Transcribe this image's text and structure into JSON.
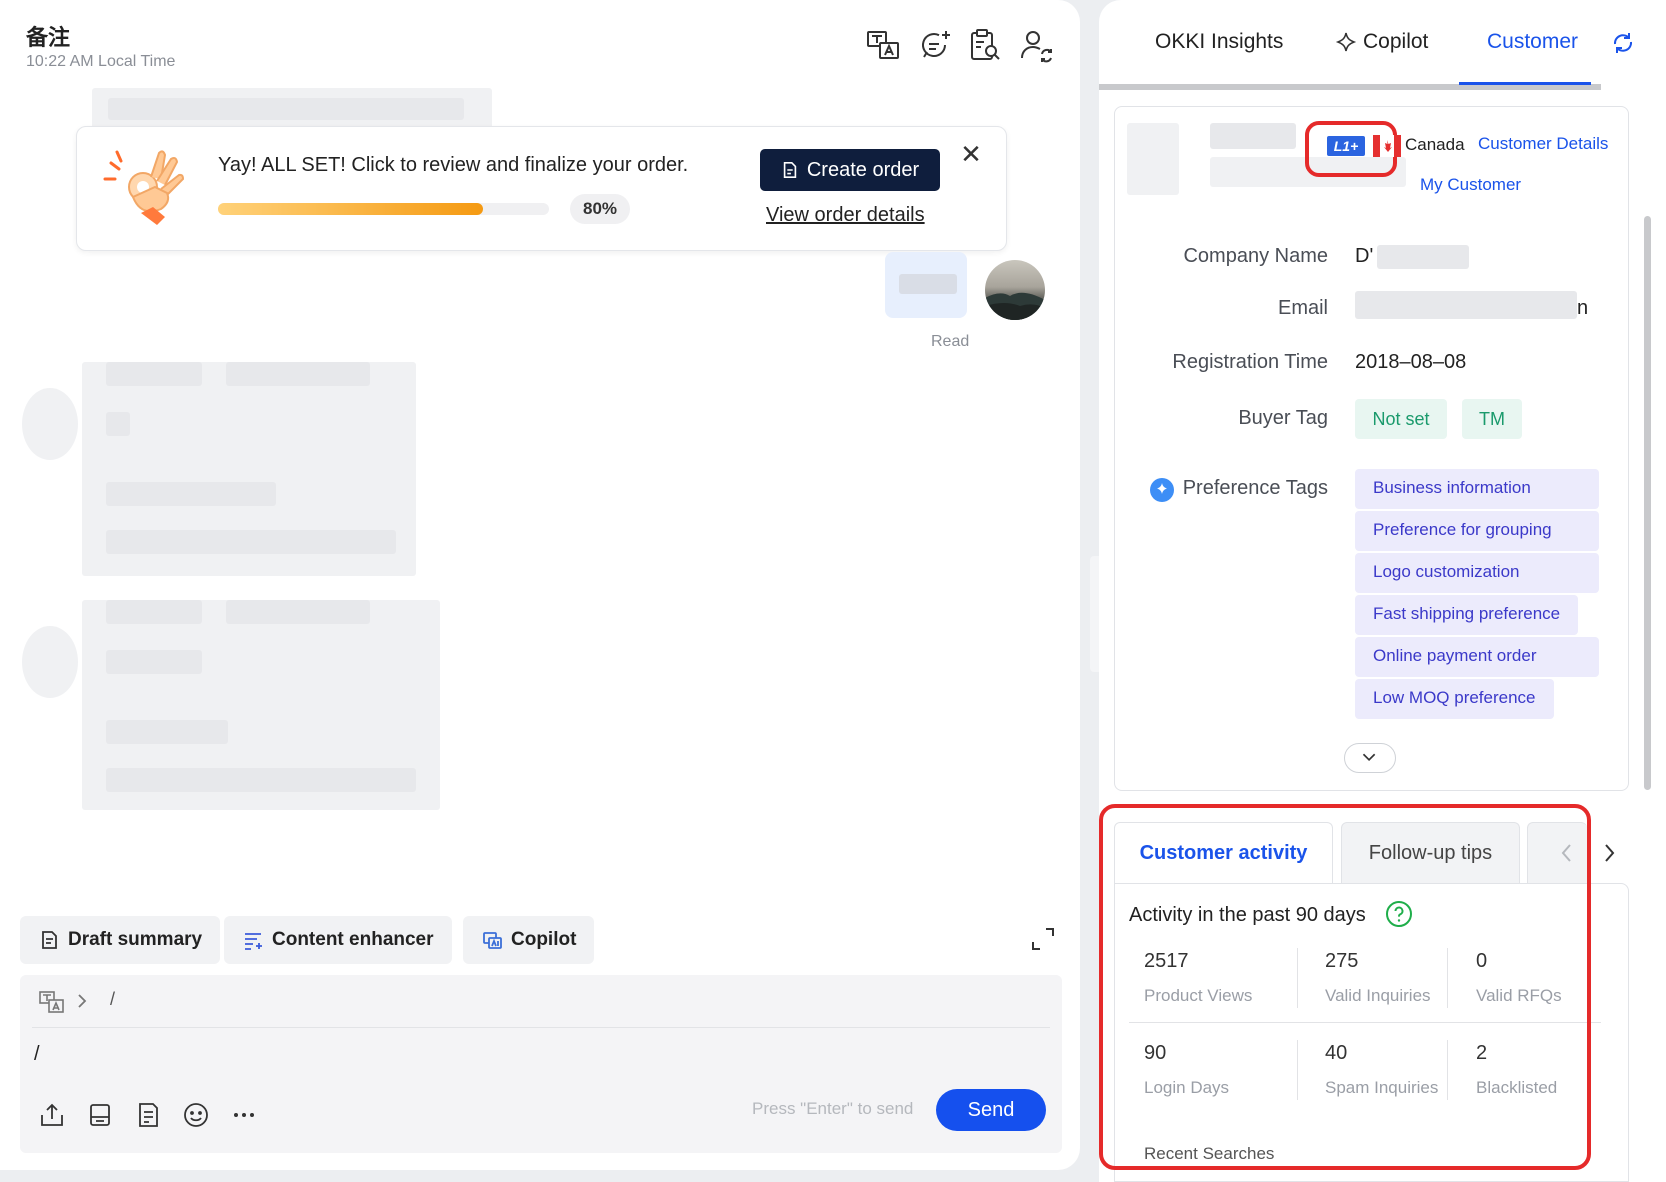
{
  "header": {
    "title": "备注",
    "local_time": "10:22 AM Local Time",
    "icons": [
      "translate-icon",
      "add-chat-icon",
      "clipboard-search-icon",
      "customer-sync-icon"
    ]
  },
  "order_card": {
    "message": "Yay! ALL SET! Click to review and finalize your order.",
    "progress": 80,
    "progress_label": "80%",
    "create_label": "Create order",
    "view_label": "View order details",
    "close_label": "✕"
  },
  "message_status": "Read",
  "assistants": {
    "draft_summary": "Draft summary",
    "content_enhancer": "Content enhancer",
    "copilot": "Copilot"
  },
  "composer": {
    "path_separator": "/",
    "input_value": "/",
    "hint": "Press \"Enter\" to send",
    "send_label": "Send"
  },
  "side_tabs": {
    "insights": "OKKI Insights",
    "copilot": "Copilot",
    "customer": "Customer"
  },
  "customer": {
    "level_badge": "L1+",
    "country": "Canada",
    "details_link": "Customer Details",
    "my_customer_link": "My Customer",
    "company_label": "Company Name",
    "company_value": "D'",
    "email_label": "Email",
    "email_value_tail": "n",
    "registration_label": "Registration Time",
    "registration_value": "2018–08–08",
    "buyer_tag_label": "Buyer Tag",
    "buyer_tags": [
      "Not set",
      "TM"
    ],
    "preference_label": "Preference Tags",
    "preference_tags": [
      "Business information",
      "Preference for grouping",
      "Logo customization",
      "Fast shipping preference",
      "Online payment order",
      "Low MOQ preference"
    ]
  },
  "activity": {
    "tabs": [
      "Customer activity",
      "Follow-up tips"
    ],
    "heading": "Activity in the past 90 days",
    "stats": [
      {
        "value": "2517",
        "label": "Product Views"
      },
      {
        "value": "275",
        "label": "Valid Inquiries"
      },
      {
        "value": "0",
        "label": "Valid RFQs"
      },
      {
        "value": "90",
        "label": "Login Days"
      },
      {
        "value": "40",
        "label": "Spam Inquiries"
      },
      {
        "value": "2",
        "label": "Blacklisted"
      }
    ],
    "recent_searches": "Recent Searches"
  },
  "colors": {
    "primary": "#1a53ea",
    "send": "#1550ee",
    "dark_button": "#0f1e3d",
    "highlight_red": "#e52a2a",
    "progress_start": "#ffd27a",
    "progress_end": "#f59a12"
  }
}
